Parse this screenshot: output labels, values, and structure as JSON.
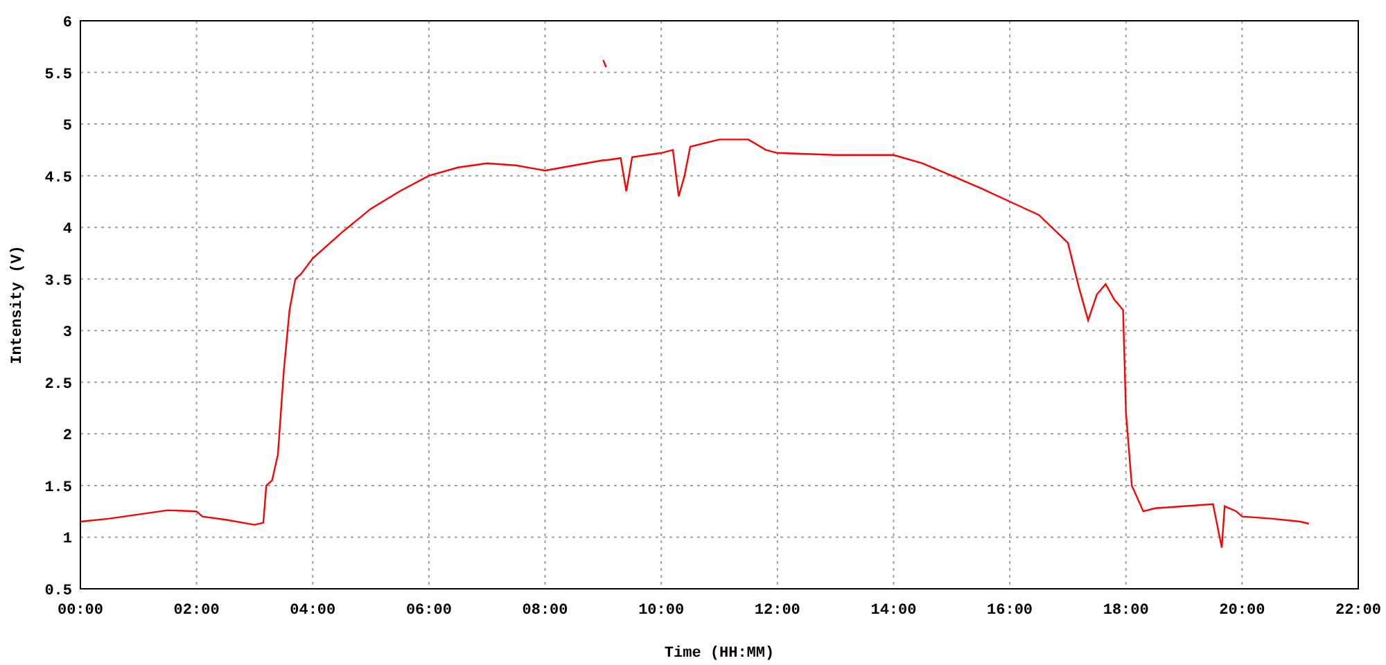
{
  "chart_data": {
    "type": "line",
    "grid": true,
    "xlabel": "Time (HH:MM)",
    "ylabel": "Intensity (V)",
    "x": [
      0,
      0.5,
      1,
      1.5,
      2,
      2.1,
      2.5,
      3,
      3.15,
      3.2,
      3.3,
      3.4,
      3.5,
      3.6,
      3.7,
      3.8,
      4,
      4.5,
      5,
      5.5,
      6,
      6.5,
      7,
      7.5,
      8,
      8.5,
      9,
      9.05,
      9.3,
      9.4,
      9.5,
      10,
      10.2,
      10.3,
      10.4,
      10.5,
      11,
      11.5,
      11.8,
      12,
      13,
      14,
      14.5,
      15,
      15.5,
      16,
      16.5,
      17,
      17.2,
      17.35,
      17.5,
      17.65,
      17.8,
      17.95,
      18,
      18.1,
      18.3,
      18.5,
      19,
      19.5,
      19.65,
      19.7,
      19.9,
      20,
      20.5,
      21,
      21.15
    ],
    "series": [
      {
        "color": "#ff0000",
        "values": [
          1.15,
          1.18,
          1.22,
          1.26,
          1.25,
          1.2,
          1.17,
          1.12,
          1.14,
          1.5,
          1.55,
          1.8,
          2.6,
          3.2,
          3.5,
          3.55,
          3.7,
          3.95,
          4.18,
          4.35,
          4.5,
          4.58,
          4.62,
          4.6,
          4.55,
          4.6,
          4.65,
          4.65,
          4.67,
          4.35,
          4.68,
          4.72,
          4.75,
          4.3,
          4.5,
          4.78,
          4.85,
          4.85,
          4.75,
          4.72,
          4.7,
          4.7,
          4.62,
          4.5,
          4.38,
          4.25,
          4.12,
          3.85,
          3.4,
          3.1,
          3.35,
          3.45,
          3.3,
          3.2,
          2.2,
          1.5,
          1.25,
          1.28,
          1.3,
          1.32,
          0.9,
          1.3,
          1.25,
          1.2,
          1.18,
          1.15,
          1.13
        ]
      },
      {
        "color": "#ff0000",
        "values": [
          null,
          null,
          null,
          null,
          null,
          null,
          null,
          null,
          null,
          null,
          null,
          null,
          null,
          null,
          null,
          null,
          null,
          null,
          null,
          null,
          null,
          null,
          null,
          null,
          null,
          null,
          5.62,
          5.55,
          null,
          null,
          null,
          null,
          null,
          null,
          null,
          null,
          null,
          null,
          null,
          null,
          null,
          null,
          null,
          null,
          null,
          null,
          null,
          null,
          null,
          null,
          null,
          null,
          null,
          null,
          null,
          null,
          null,
          null,
          null,
          null,
          null,
          null,
          null,
          null,
          null,
          null,
          null
        ]
      }
    ],
    "xlim": [
      0,
      22
    ],
    "ylim": [
      0.5,
      6
    ],
    "xticks": [
      {
        "value": 0,
        "label": "00:00"
      },
      {
        "value": 2,
        "label": "02:00"
      },
      {
        "value": 4,
        "label": "04:00"
      },
      {
        "value": 6,
        "label": "06:00"
      },
      {
        "value": 8,
        "label": "08:00"
      },
      {
        "value": 10,
        "label": "10:00"
      },
      {
        "value": 12,
        "label": "12:00"
      },
      {
        "value": 14,
        "label": "14:00"
      },
      {
        "value": 16,
        "label": "16:00"
      },
      {
        "value": 18,
        "label": "18:00"
      },
      {
        "value": 20,
        "label": "20:00"
      },
      {
        "value": 22,
        "label": "22:00"
      }
    ],
    "yticks": [
      {
        "value": 0.5,
        "label": "0.5"
      },
      {
        "value": 1,
        "label": "1"
      },
      {
        "value": 1.5,
        "label": "1.5"
      },
      {
        "value": 2,
        "label": "2"
      },
      {
        "value": 2.5,
        "label": "2.5"
      },
      {
        "value": 3,
        "label": "3"
      },
      {
        "value": 3.5,
        "label": "3.5"
      },
      {
        "value": 4,
        "label": "4"
      },
      {
        "value": 4.5,
        "label": "4.5"
      },
      {
        "value": 5,
        "label": "5"
      },
      {
        "value": 5.5,
        "label": "5.5"
      },
      {
        "value": 6,
        "label": "6"
      }
    ]
  }
}
